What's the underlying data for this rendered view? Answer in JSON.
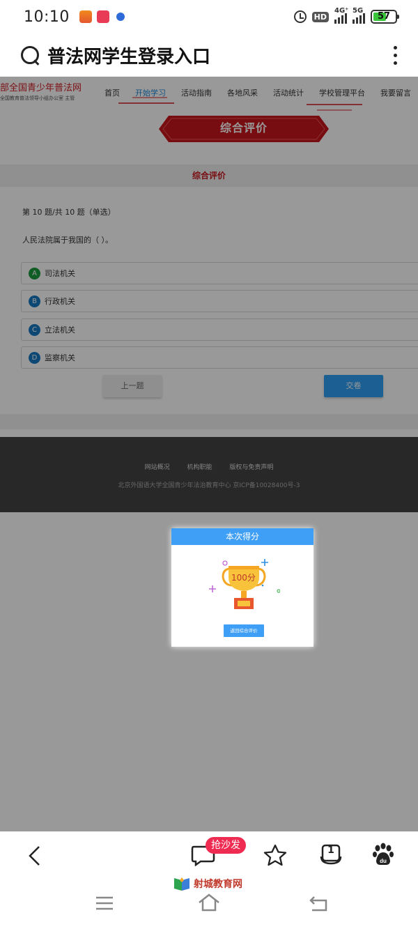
{
  "status_bar": {
    "time": "10:10",
    "signal_1": "4G⁺",
    "signal_2": "5G",
    "battery": "57",
    "hd": "HD"
  },
  "search": {
    "query": "普法网学生登录入口"
  },
  "site": {
    "logo_title": "部全国青少年普法网",
    "logo_subtitle": "全国教育普法领导小组办公室 主管",
    "nav": [
      "首页",
      "开始学习",
      "活动指南",
      "各地风采",
      "活动统计",
      "学校管理平台",
      "我要留言"
    ],
    "banner_title": "综合评价",
    "section_title": "综合评价"
  },
  "quiz": {
    "progress": "第 10 题/共 10 题（单选）",
    "question": "人民法院属于我国的（ ）。",
    "options": [
      {
        "key": "A",
        "label": "司法机关",
        "color": "#1a9b3e"
      },
      {
        "key": "B",
        "label": "行政机关",
        "color": "#1679c4"
      },
      {
        "key": "C",
        "label": "立法机关",
        "color": "#1679c4"
      },
      {
        "key": "D",
        "label": "监察机关",
        "color": "#1679c4"
      }
    ],
    "prev_label": "上一题",
    "submit_label": "交卷"
  },
  "footer": {
    "links": [
      "网站概况",
      "机构职能",
      "版权与免责声明"
    ],
    "icp": "北京外国语大学全国青少年法治教育中心 京ICP备10028400号-3"
  },
  "modal": {
    "title": "本次得分",
    "score": "100分",
    "button_label": "返回综合评价"
  },
  "toolbar": {
    "sofa_badge": "抢沙发",
    "tabs_count": "1",
    "watermark": "射城教育网"
  }
}
